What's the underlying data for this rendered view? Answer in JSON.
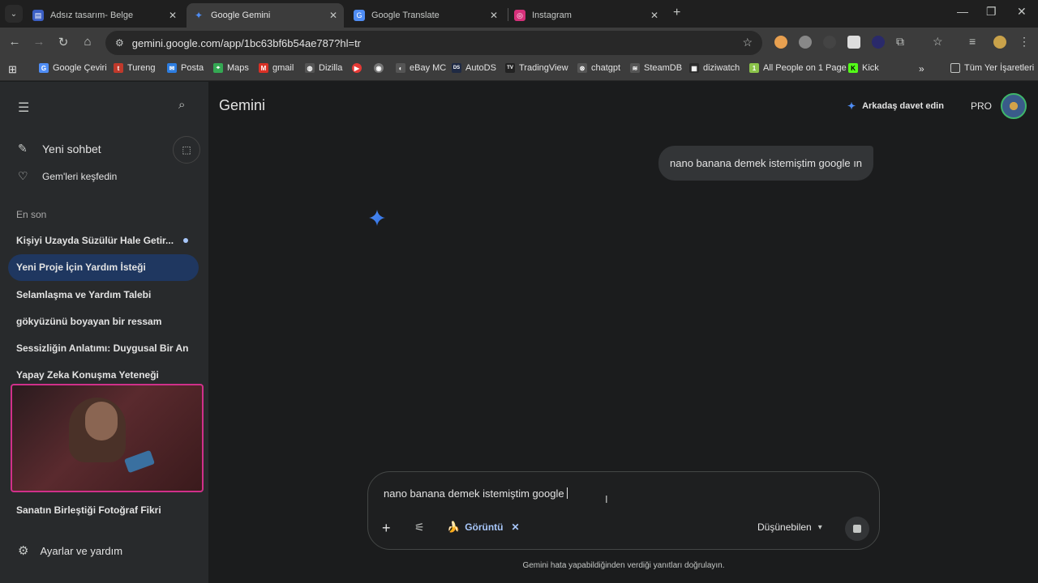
{
  "browser": {
    "tabs": [
      {
        "title": "Adsız tasarım- Belge",
        "color": "#3b5fc4",
        "glyph": "▤"
      },
      {
        "title": "Google Gemini",
        "color": "#4f8df5",
        "glyph": "✦"
      },
      {
        "title": "Google Translate",
        "color": "#4f8df5",
        "glyph": "G"
      },
      {
        "title": "Instagram",
        "color": "#d6307a",
        "glyph": "◎"
      }
    ],
    "url": "gemini.google.com/app/1bc63bf6b54ae787?hl=tr",
    "bookmarks": [
      {
        "label": "Google Çeviri",
        "color": "#4f8df5",
        "glyph": "G"
      },
      {
        "label": "Tureng",
        "color": "#c0392b",
        "glyph": "t"
      },
      {
        "label": "Posta",
        "color": "#2d7de0",
        "glyph": "✉"
      },
      {
        "label": "Maps",
        "color": "#34a853",
        "glyph": "⌖"
      },
      {
        "label": "gmail",
        "color": "#d93025",
        "glyph": "M"
      },
      {
        "label": "Dizilla",
        "color": "#555",
        "glyph": "◍"
      },
      {
        "label": "",
        "color": "#e53935",
        "glyph": "▶"
      },
      {
        "label": "",
        "color": "#777",
        "glyph": "◉"
      },
      {
        "label": "eBay MC",
        "color": "#555",
        "glyph": "◐"
      },
      {
        "label": "AutoDS",
        "color": "#1f2a44",
        "glyph": "DS"
      },
      {
        "label": "TradingView",
        "color": "#222",
        "glyph": "TV"
      },
      {
        "label": "chatgpt",
        "color": "#555",
        "glyph": "⊛"
      },
      {
        "label": "SteamDB",
        "color": "#555",
        "glyph": "≋"
      },
      {
        "label": "diziwatch",
        "color": "#2a2a2a",
        "glyph": "▦"
      },
      {
        "label": "All People on 1 Page",
        "color": "#8bc34a",
        "glyph": "1"
      },
      {
        "label": "Kick",
        "color": "#53fc18",
        "glyph": "K"
      }
    ],
    "all_bookmarks_label": "Tüm Yer İşaretleri"
  },
  "sidebar": {
    "new_chat": "Yeni sohbet",
    "explore_gems": "Gem'leri keşfedin",
    "recent_label": "En son",
    "recents": [
      "Kişiyi Uzayda Süzülür Hale Getir...",
      "Yeni Proje İçin Yardım İsteği",
      "Selamlaşma ve Yardım Talebi",
      "gökyüzünü boyayan bir ressam",
      "Sessizliğin Anlatımı: Duygusal Bir An",
      "Yapay Zeka Konuşma Yeteneği",
      "Sanatın Birleştiği Fotoğraf Fikri"
    ],
    "settings": "Ayarlar ve yardım"
  },
  "header": {
    "brand": "Gemini",
    "invite": "Arkadaş davet edin",
    "plan": "PRO"
  },
  "conversation": {
    "user_message": "nano banana demek istemiştim google ın"
  },
  "composer": {
    "text": "nano banana demek istemiştim google",
    "chip_label": "Görüntü",
    "mode": "Düşünebilen"
  },
  "footer": {
    "disclaimer": "Gemini hata yapabildiğinden verdiği yanıtları doğrulayın."
  }
}
